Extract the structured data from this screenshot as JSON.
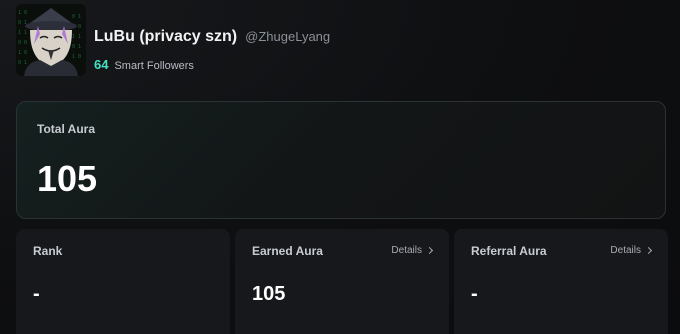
{
  "profile": {
    "display_name": "LuBu (privacy szn)",
    "handle": "@ZhugeLyang",
    "smart_followers_count": "64",
    "smart_followers_label": "Smart Followers"
  },
  "total_aura": {
    "label": "Total Aura",
    "value": "105"
  },
  "stats": {
    "rank": {
      "label": "Rank",
      "value": "-"
    },
    "earned": {
      "label": "Earned Aura",
      "value": "105",
      "details": "Details"
    },
    "referral": {
      "label": "Referral Aura",
      "value": "-",
      "details": "Details"
    }
  },
  "colors": {
    "accent": "#46e0c4",
    "background": "#0b0c0e",
    "card": "#16181b"
  }
}
